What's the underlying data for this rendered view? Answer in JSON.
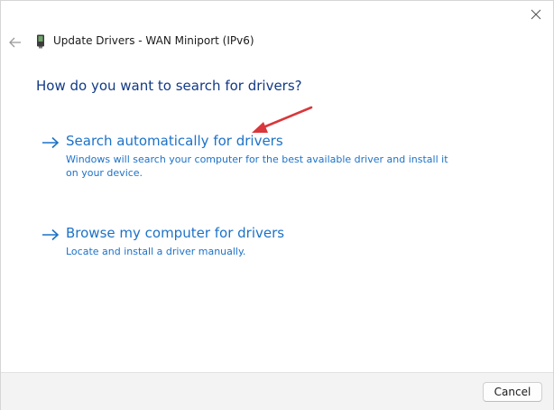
{
  "window": {
    "title": "Update Drivers - WAN Miniport (IPv6)",
    "back_icon": "arrow-left-icon",
    "close_icon": "close-icon",
    "device_icon": "network-adapter-icon"
  },
  "main": {
    "heading": "How do you want to search for drivers?",
    "options": [
      {
        "title": "Search automatically for drivers",
        "description": "Windows will search your computer for the best available driver and install it on your device.",
        "icon": "arrow-right-icon"
      },
      {
        "title": "Browse my computer for drivers",
        "description": "Locate and install a driver manually.",
        "icon": "arrow-right-icon"
      }
    ],
    "annotation_color": "#d9373b"
  },
  "footer": {
    "cancel_label": "Cancel"
  },
  "colors": {
    "heading": "#123a86",
    "link": "#1c72c8",
    "footer_bg": "#f3f3f3"
  }
}
